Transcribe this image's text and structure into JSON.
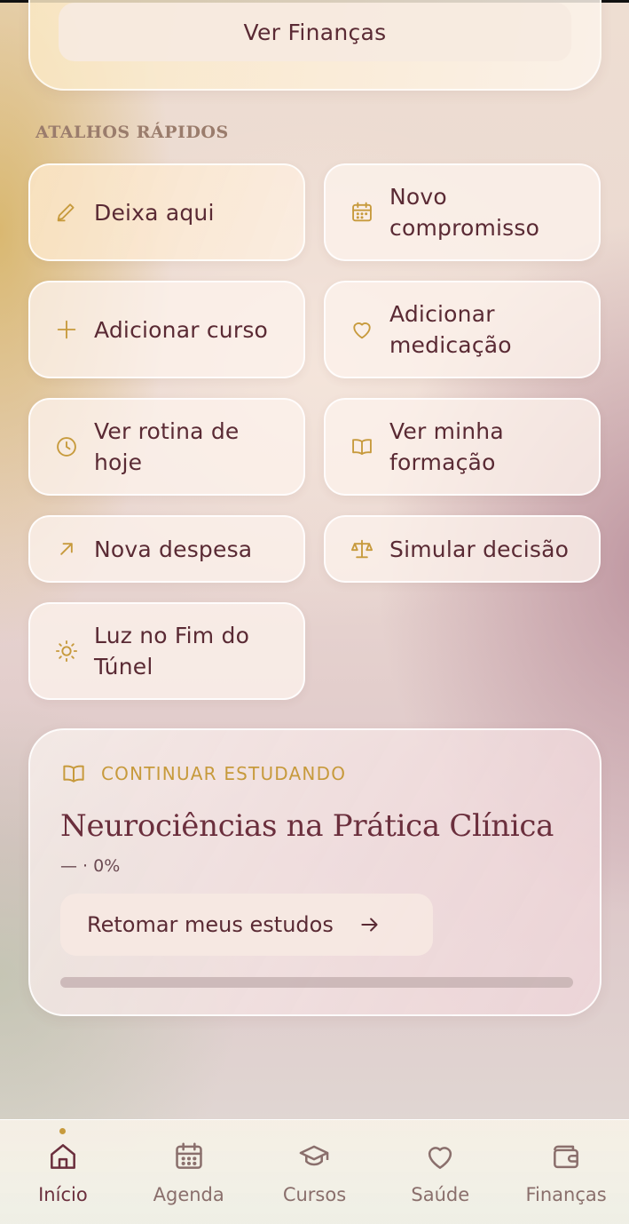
{
  "finance_card": {
    "button_label": "Ver Finanças"
  },
  "shortcuts": {
    "title": "ATALHOS RÁPIDOS",
    "items": [
      {
        "label": "Deixa aqui",
        "icon": "pencil-icon"
      },
      {
        "label": "Novo compromisso",
        "icon": "calendar-icon"
      },
      {
        "label": "Adicionar curso",
        "icon": "plus-icon"
      },
      {
        "label": "Adicionar medicação",
        "icon": "heart-icon"
      },
      {
        "label": "Ver rotina de hoje",
        "icon": "clock-icon"
      },
      {
        "label": "Ver minha formação",
        "icon": "book-icon"
      },
      {
        "label": "Nova despesa",
        "icon": "arrow-up-right-icon"
      },
      {
        "label": "Simular decisão",
        "icon": "scale-icon"
      },
      {
        "label": "Luz no Fim do Túnel",
        "icon": "sun-icon"
      }
    ]
  },
  "study": {
    "header": "CONTINUAR ESTUDANDO",
    "course_title": "Neurociências na Prática Clínica",
    "meta": "— · 0%",
    "progress_fraction": 0,
    "resume_label": "Retomar meus estudos"
  },
  "nav": {
    "items": [
      {
        "label": "Início",
        "icon": "home-icon",
        "active": true
      },
      {
        "label": "Agenda",
        "icon": "calendar-icon",
        "active": false
      },
      {
        "label": "Cursos",
        "icon": "graduation-cap-icon",
        "active": false
      },
      {
        "label": "Saúde",
        "icon": "heart-icon",
        "active": false
      },
      {
        "label": "Finanças",
        "icon": "wallet-icon",
        "active": false
      }
    ]
  },
  "colors": {
    "accent_gold": "#c79a3c",
    "text_wine": "#6b2f3d",
    "nav_inactive": "#8a6f6c"
  }
}
